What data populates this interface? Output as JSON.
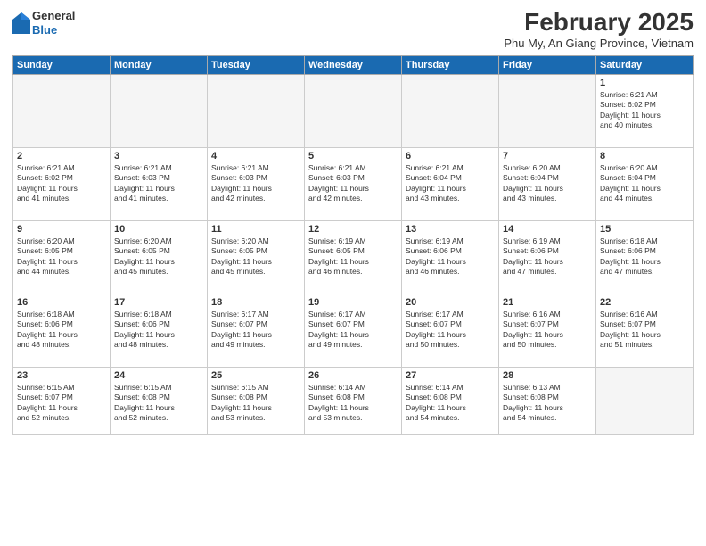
{
  "header": {
    "logo_general": "General",
    "logo_blue": "Blue",
    "month_title": "February 2025",
    "location": "Phu My, An Giang Province, Vietnam"
  },
  "days_of_week": [
    "Sunday",
    "Monday",
    "Tuesday",
    "Wednesday",
    "Thursday",
    "Friday",
    "Saturday"
  ],
  "weeks": [
    [
      {
        "day": "",
        "info": ""
      },
      {
        "day": "",
        "info": ""
      },
      {
        "day": "",
        "info": ""
      },
      {
        "day": "",
        "info": ""
      },
      {
        "day": "",
        "info": ""
      },
      {
        "day": "",
        "info": ""
      },
      {
        "day": "1",
        "info": "Sunrise: 6:21 AM\nSunset: 6:02 PM\nDaylight: 11 hours\nand 40 minutes."
      }
    ],
    [
      {
        "day": "2",
        "info": "Sunrise: 6:21 AM\nSunset: 6:02 PM\nDaylight: 11 hours\nand 41 minutes."
      },
      {
        "day": "3",
        "info": "Sunrise: 6:21 AM\nSunset: 6:03 PM\nDaylight: 11 hours\nand 41 minutes."
      },
      {
        "day": "4",
        "info": "Sunrise: 6:21 AM\nSunset: 6:03 PM\nDaylight: 11 hours\nand 42 minutes."
      },
      {
        "day": "5",
        "info": "Sunrise: 6:21 AM\nSunset: 6:03 PM\nDaylight: 11 hours\nand 42 minutes."
      },
      {
        "day": "6",
        "info": "Sunrise: 6:21 AM\nSunset: 6:04 PM\nDaylight: 11 hours\nand 43 minutes."
      },
      {
        "day": "7",
        "info": "Sunrise: 6:20 AM\nSunset: 6:04 PM\nDaylight: 11 hours\nand 43 minutes."
      },
      {
        "day": "8",
        "info": "Sunrise: 6:20 AM\nSunset: 6:04 PM\nDaylight: 11 hours\nand 44 minutes."
      }
    ],
    [
      {
        "day": "9",
        "info": "Sunrise: 6:20 AM\nSunset: 6:05 PM\nDaylight: 11 hours\nand 44 minutes."
      },
      {
        "day": "10",
        "info": "Sunrise: 6:20 AM\nSunset: 6:05 PM\nDaylight: 11 hours\nand 45 minutes."
      },
      {
        "day": "11",
        "info": "Sunrise: 6:20 AM\nSunset: 6:05 PM\nDaylight: 11 hours\nand 45 minutes."
      },
      {
        "day": "12",
        "info": "Sunrise: 6:19 AM\nSunset: 6:05 PM\nDaylight: 11 hours\nand 46 minutes."
      },
      {
        "day": "13",
        "info": "Sunrise: 6:19 AM\nSunset: 6:06 PM\nDaylight: 11 hours\nand 46 minutes."
      },
      {
        "day": "14",
        "info": "Sunrise: 6:19 AM\nSunset: 6:06 PM\nDaylight: 11 hours\nand 47 minutes."
      },
      {
        "day": "15",
        "info": "Sunrise: 6:18 AM\nSunset: 6:06 PM\nDaylight: 11 hours\nand 47 minutes."
      }
    ],
    [
      {
        "day": "16",
        "info": "Sunrise: 6:18 AM\nSunset: 6:06 PM\nDaylight: 11 hours\nand 48 minutes."
      },
      {
        "day": "17",
        "info": "Sunrise: 6:18 AM\nSunset: 6:06 PM\nDaylight: 11 hours\nand 48 minutes."
      },
      {
        "day": "18",
        "info": "Sunrise: 6:17 AM\nSunset: 6:07 PM\nDaylight: 11 hours\nand 49 minutes."
      },
      {
        "day": "19",
        "info": "Sunrise: 6:17 AM\nSunset: 6:07 PM\nDaylight: 11 hours\nand 49 minutes."
      },
      {
        "day": "20",
        "info": "Sunrise: 6:17 AM\nSunset: 6:07 PM\nDaylight: 11 hours\nand 50 minutes."
      },
      {
        "day": "21",
        "info": "Sunrise: 6:16 AM\nSunset: 6:07 PM\nDaylight: 11 hours\nand 50 minutes."
      },
      {
        "day": "22",
        "info": "Sunrise: 6:16 AM\nSunset: 6:07 PM\nDaylight: 11 hours\nand 51 minutes."
      }
    ],
    [
      {
        "day": "23",
        "info": "Sunrise: 6:15 AM\nSunset: 6:07 PM\nDaylight: 11 hours\nand 52 minutes."
      },
      {
        "day": "24",
        "info": "Sunrise: 6:15 AM\nSunset: 6:08 PM\nDaylight: 11 hours\nand 52 minutes."
      },
      {
        "day": "25",
        "info": "Sunrise: 6:15 AM\nSunset: 6:08 PM\nDaylight: 11 hours\nand 53 minutes."
      },
      {
        "day": "26",
        "info": "Sunrise: 6:14 AM\nSunset: 6:08 PM\nDaylight: 11 hours\nand 53 minutes."
      },
      {
        "day": "27",
        "info": "Sunrise: 6:14 AM\nSunset: 6:08 PM\nDaylight: 11 hours\nand 54 minutes."
      },
      {
        "day": "28",
        "info": "Sunrise: 6:13 AM\nSunset: 6:08 PM\nDaylight: 11 hours\nand 54 minutes."
      },
      {
        "day": "",
        "info": ""
      }
    ]
  ]
}
